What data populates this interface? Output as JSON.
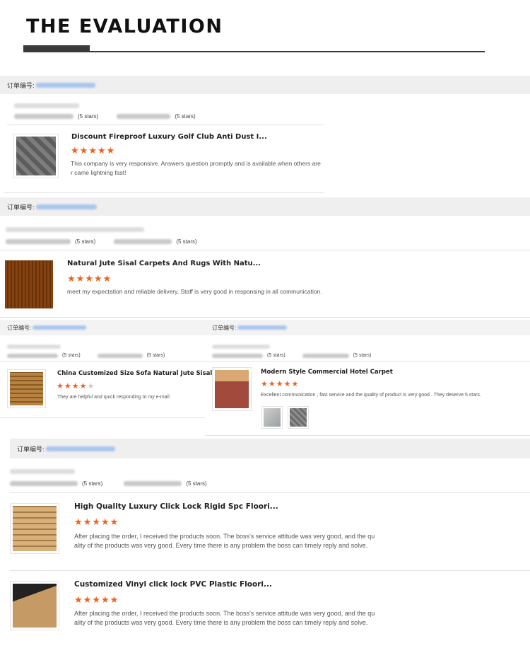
{
  "header": {
    "title": "THE EVALUATION"
  },
  "order_label": "订单编号:",
  "stars_label": "(5 stars)",
  "reviews": [
    {
      "title": "Discount Fireproof Luxury Golf Club Anti Dust I...",
      "rating": 5,
      "text_line1": "This company is very responsive. Answers question promptly and is available when others are",
      "text_line2": "r came lightning fast!"
    },
    {
      "title": "Natural Jute Sisal Carpets And Rugs With Natu...",
      "rating": 5,
      "text_line1": "meet my expectation and reliable delivery. Staff is very good in responsing in all communication."
    },
    {
      "title": "China Customized Size Sofa Natural Jute Sisal ...",
      "rating": 4,
      "text_line1": "They are helpful and quick responding to my e-mail"
    },
    {
      "title": "Modern Style Commercial Hotel Carpet",
      "rating": 5,
      "text_line1": "Excellent communication , fast service and the quality of product is very good . They deserve 5 stars."
    },
    {
      "title": "High Quality Luxury Click Lock Rigid Spc Floori...",
      "rating": 5,
      "text_line1": "After placing the order, I received the products soon. The boss's service attitude was very good, and the qu",
      "text_line2": "ality of the products was very good. Every time there is any problem the boss can timely reply and solve."
    },
    {
      "title": "Customized Vinyl click lock PVC Plastic Floori...",
      "rating": 5,
      "text_line1": "After placing the order, I received the products soon. The boss's service attitude was very good, and the qu",
      "text_line2": "ality of the products was very good. Every time there is any problem the boss can timely reply and solve."
    }
  ],
  "colors": {
    "star": "#f0611c",
    "star_empty": "#c8c8c8",
    "order_bar": "#efefef",
    "blurred_link": "#a9c6ee"
  },
  "icons": [
    "star-icon",
    "product-thumbnail"
  ]
}
